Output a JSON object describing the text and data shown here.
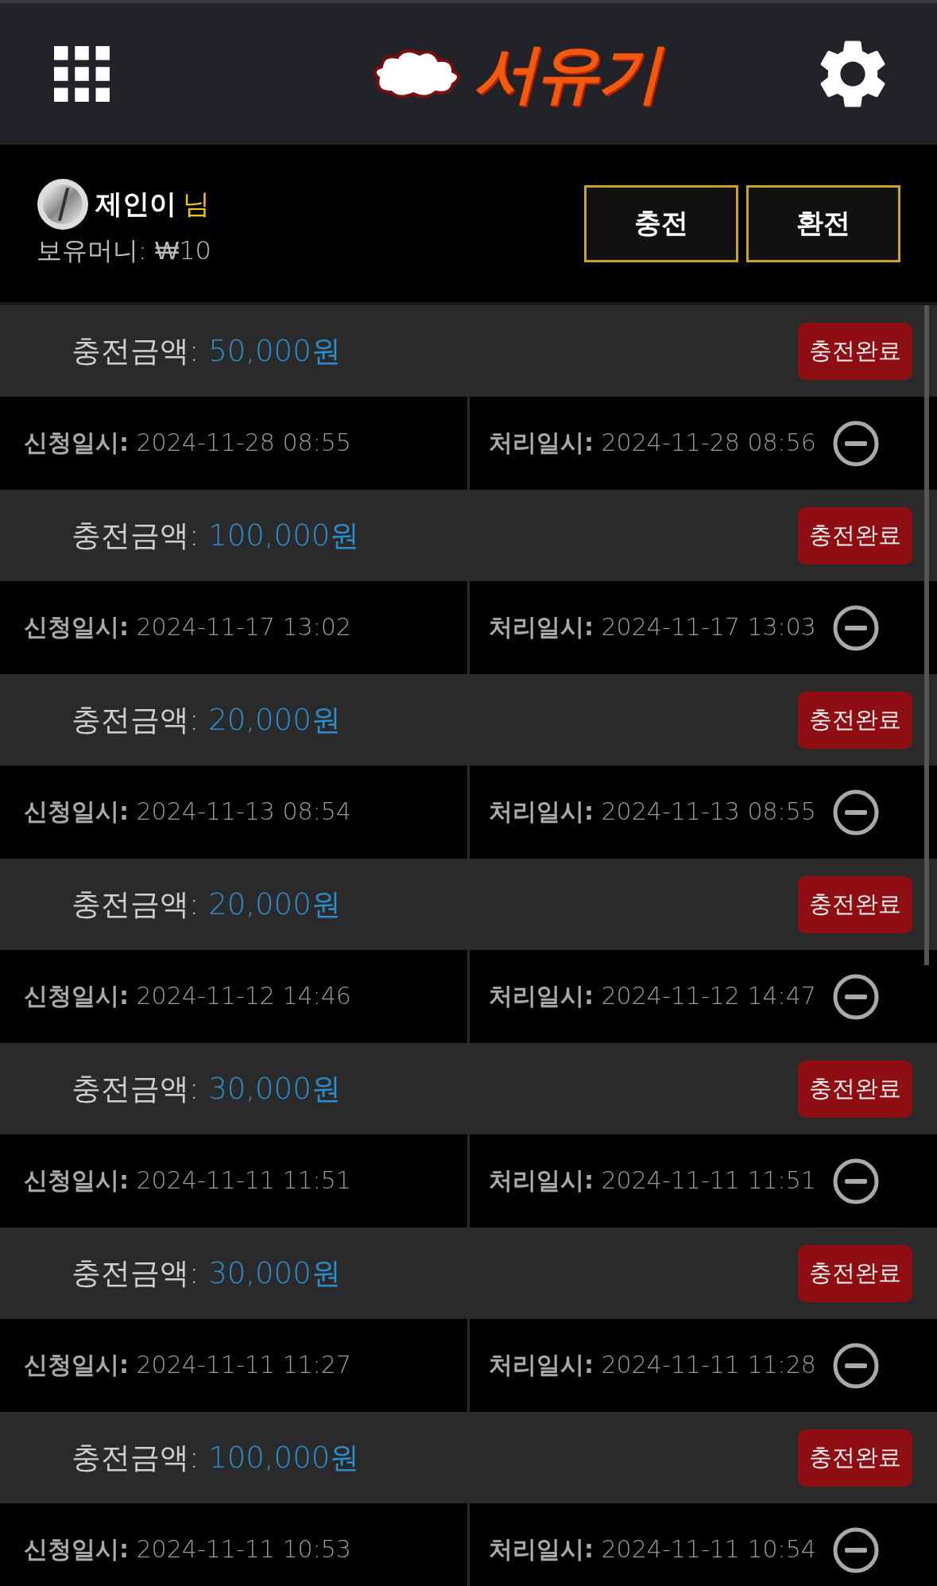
{
  "header": {
    "logo_text": "서유기"
  },
  "user": {
    "name": "제인이",
    "suffix": "님",
    "balance_label": "보유머니:",
    "balance": "₩10"
  },
  "buttons": [
    "충전",
    "환전"
  ],
  "records": [
    {
      "amount_label": "충전금액:",
      "amount": "50,000원",
      "status": "충전완료",
      "request_label": "신청일시:",
      "request_time": "2024-11-28 08:55",
      "process_label": "처리일시:",
      "process_time": "2024-11-28 08:56"
    },
    {
      "amount_label": "충전금액:",
      "amount": "100,000원",
      "status": "충전완료",
      "request_label": "신청일시:",
      "request_time": "2024-11-17 13:02",
      "process_label": "처리일시:",
      "process_time": "2024-11-17 13:03"
    },
    {
      "amount_label": "충전금액:",
      "amount": "20,000원",
      "status": "충전완료",
      "request_label": "신청일시:",
      "request_time": "2024-11-13 08:54",
      "process_label": "처리일시:",
      "process_time": "2024-11-13 08:55"
    },
    {
      "amount_label": "충전금액:",
      "amount": "20,000원",
      "status": "충전완료",
      "request_label": "신청일시:",
      "request_time": "2024-11-12 14:46",
      "process_label": "처리일시:",
      "process_time": "2024-11-12 14:47"
    },
    {
      "amount_label": "충전금액:",
      "amount": "30,000원",
      "status": "충전완료",
      "request_label": "신청일시:",
      "request_time": "2024-11-11 11:51",
      "process_label": "처리일시:",
      "process_time": "2024-11-11 11:51"
    },
    {
      "amount_label": "충전금액:",
      "amount": "30,000원",
      "status": "충전완료",
      "request_label": "신청일시:",
      "request_time": "2024-11-11 11:27",
      "process_label": "처리일시:",
      "process_time": "2024-11-11 11:28"
    },
    {
      "amount_label": "충전금액:",
      "amount": "100,000원",
      "status": "충전완료",
      "request_label": "신청일시:",
      "request_time": "2024-11-11 10:53",
      "process_label": "처리일시:",
      "process_time": "2024-11-11 10:54"
    }
  ]
}
